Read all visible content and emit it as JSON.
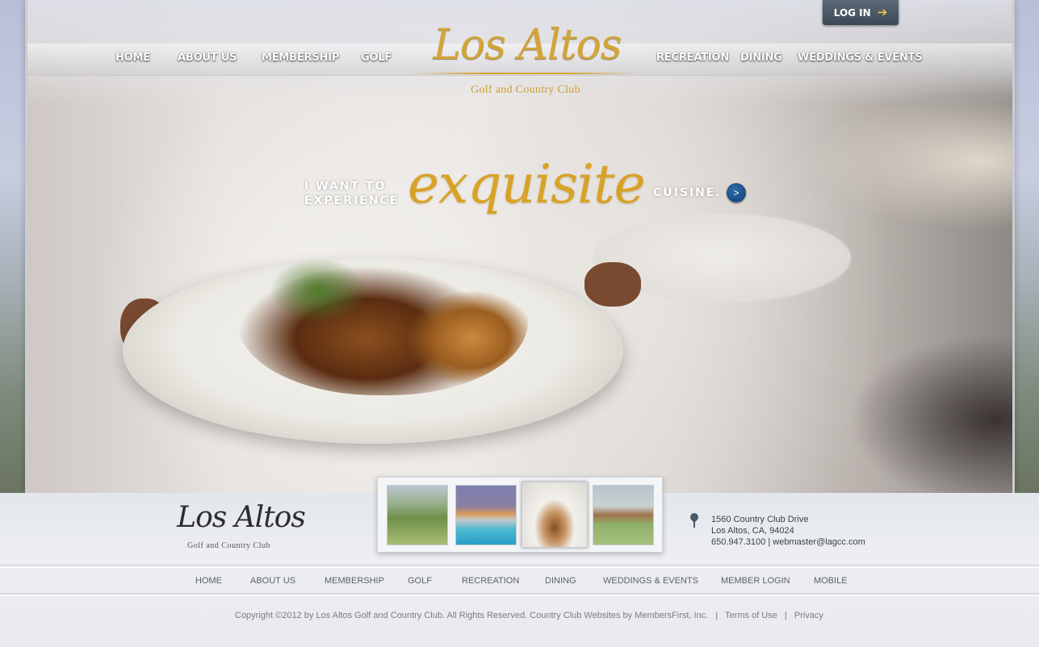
{
  "header": {
    "login_label": "LOG IN",
    "logo_title": "Los Altos",
    "logo_subtitle": "Golf and Country Club",
    "nav_left": [
      "HOME",
      "ABOUT US",
      "MEMBERSHIP",
      "GOLF"
    ],
    "nav_right": [
      "RECREATION",
      "DINING",
      "WEDDINGS & EVENTS"
    ]
  },
  "hero": {
    "tagline_pre_line1": "I WANT TO",
    "tagline_pre_line2": "EXPERIENCE",
    "tagline_highlight": "exquisite",
    "tagline_post": "CUISINE.",
    "go_button": ">"
  },
  "footer": {
    "logo_title": "Los Altos",
    "logo_subtitle": "Golf and Country Club",
    "address_line1": "1560 Country Club Drive",
    "address_line2": "Los Altos, CA, 94024",
    "phone": "650.947.3100",
    "email": "webmaster@lagcc.com",
    "nav": [
      "HOME",
      "ABOUT US",
      "MEMBERSHIP",
      "GOLF",
      "RECREATION",
      "DINING",
      "WEDDINGS & EVENTS",
      "MEMBER LOGIN",
      "MOBILE"
    ],
    "copyright": "Copyright ©2012 by Los Altos Golf and Country Club. All Rights Reserved. Country Club Websites by MembersFirst, Inc.",
    "terms": "Terms of Use",
    "privacy": "Privacy"
  },
  "colors": {
    "gold": "#d4a437",
    "navy_button": "#1a4f86",
    "footer_bg": "#e8eaee"
  }
}
